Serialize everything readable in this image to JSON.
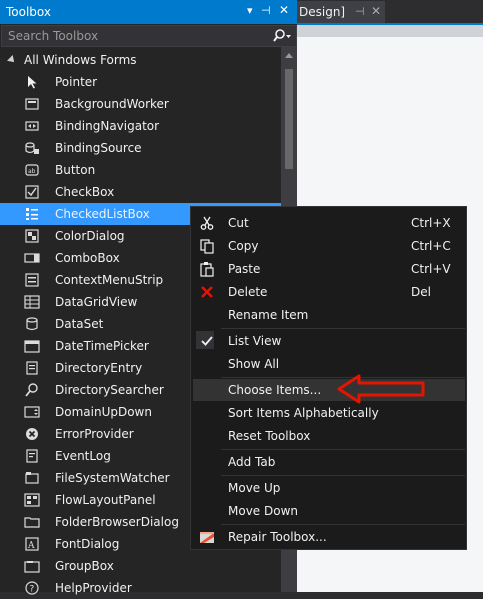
{
  "toolbox": {
    "title": "Toolbox",
    "search_placeholder": "Search Toolbox",
    "group_label": "All Windows Forms",
    "items": [
      {
        "label": "Pointer",
        "icon": "pointer-icon"
      },
      {
        "label": "BackgroundWorker",
        "icon": "backgroundworker-icon"
      },
      {
        "label": "BindingNavigator",
        "icon": "bindingnavigator-icon"
      },
      {
        "label": "BindingSource",
        "icon": "bindingsource-icon"
      },
      {
        "label": "Button",
        "icon": "button-icon"
      },
      {
        "label": "CheckBox",
        "icon": "checkbox-icon"
      },
      {
        "label": "CheckedListBox",
        "icon": "checkedlistbox-icon"
      },
      {
        "label": "ColorDialog",
        "icon": "colordialog-icon"
      },
      {
        "label": "ComboBox",
        "icon": "combobox-icon"
      },
      {
        "label": "ContextMenuStrip",
        "icon": "contextmenustrip-icon"
      },
      {
        "label": "DataGridView",
        "icon": "datagridview-icon"
      },
      {
        "label": "DataSet",
        "icon": "dataset-icon"
      },
      {
        "label": "DateTimePicker",
        "icon": "datetimepicker-icon"
      },
      {
        "label": "DirectoryEntry",
        "icon": "directoryentry-icon"
      },
      {
        "label": "DirectorySearcher",
        "icon": "directorysearcher-icon"
      },
      {
        "label": "DomainUpDown",
        "icon": "domainupdown-icon"
      },
      {
        "label": "ErrorProvider",
        "icon": "errorprovider-icon"
      },
      {
        "label": "EventLog",
        "icon": "eventlog-icon"
      },
      {
        "label": "FileSystemWatcher",
        "icon": "filesystemwatcher-icon"
      },
      {
        "label": "FlowLayoutPanel",
        "icon": "flowlayoutpanel-icon"
      },
      {
        "label": "FolderBrowserDialog",
        "icon": "folderbrowserdialog-icon"
      },
      {
        "label": "FontDialog",
        "icon": "fontdialog-icon"
      },
      {
        "label": "GroupBox",
        "icon": "groupbox-icon"
      },
      {
        "label": "HelpProvider",
        "icon": "helpprovider-icon"
      }
    ]
  },
  "document_tab": {
    "label": "Design]"
  },
  "context_menu": {
    "cut": {
      "label": "Cut",
      "shortcut": "Ctrl+X"
    },
    "copy": {
      "label": "Copy",
      "shortcut": "Ctrl+C"
    },
    "paste": {
      "label": "Paste",
      "shortcut": "Ctrl+V"
    },
    "delete": {
      "label": "Delete",
      "shortcut": "Del"
    },
    "rename": {
      "label": "Rename Item"
    },
    "list_view": {
      "label": "List View"
    },
    "show_all": {
      "label": "Show All"
    },
    "choose_items": {
      "label": "Choose Items..."
    },
    "sort": {
      "label": "Sort Items Alphabetically"
    },
    "reset": {
      "label": "Reset Toolbox"
    },
    "add_tab": {
      "label": "Add Tab"
    },
    "move_up": {
      "label": "Move Up"
    },
    "move_down": {
      "label": "Move Down"
    },
    "repair": {
      "label": "Repair Toolbox..."
    }
  },
  "colors": {
    "accent": "#007acc",
    "selection": "#3399ff",
    "panel": "#252526",
    "annotation_arrow": "#e51400"
  }
}
